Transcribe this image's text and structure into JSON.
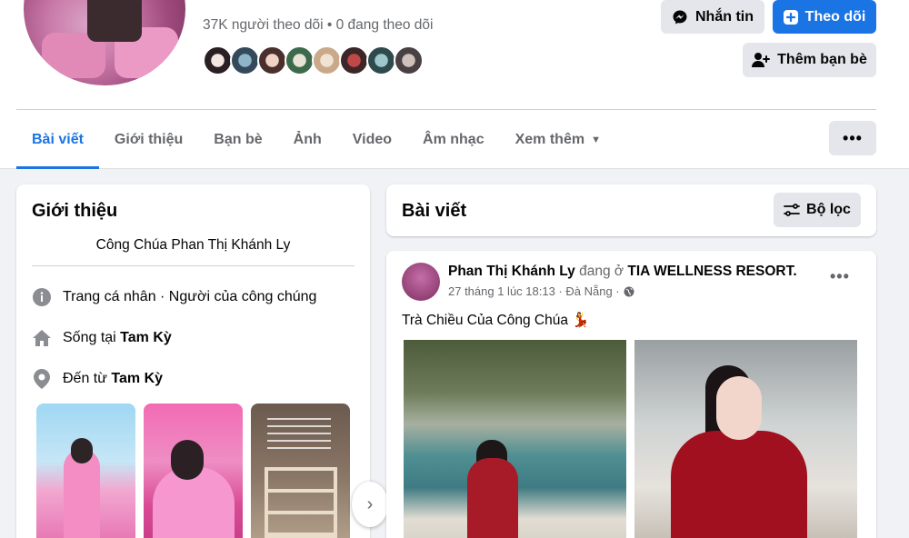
{
  "profile": {
    "follow_stats": "37K người theo dõi • 0 đang theo dõi",
    "friend_count_shown": 8
  },
  "actions": {
    "message_label": "Nhắn tin",
    "follow_label": "Theo dõi",
    "add_friend_label": "Thêm bạn bè"
  },
  "tabs": [
    {
      "label": "Bài viết",
      "active": true
    },
    {
      "label": "Giới thiệu"
    },
    {
      "label": "Bạn bè"
    },
    {
      "label": "Ảnh"
    },
    {
      "label": "Video"
    },
    {
      "label": "Âm nhạc"
    },
    {
      "label": "Xem thêm"
    }
  ],
  "more_menu_label": "•••",
  "intro": {
    "title": "Giới thiệu",
    "bio": "Công Chúa Phan Thị Khánh Ly",
    "rows": [
      {
        "icon": "info-icon",
        "prefix": "Trang cá nhân · Người của công chúng",
        "bold": ""
      },
      {
        "icon": "home-icon",
        "prefix": "Sống tại ",
        "bold": "Tam Kỳ"
      },
      {
        "icon": "location-pin-icon",
        "prefix": "Đến từ ",
        "bold": "Tam Kỳ"
      }
    ]
  },
  "posts_header": {
    "title": "Bài viết",
    "filter_label": "Bộ lọc"
  },
  "post": {
    "author": "Phan Thị Khánh Ly",
    "action": " đang ở ",
    "place": "TIA WELLNESS RESORT.",
    "timestamp": "27 tháng 1 lúc 18:13 · Đà Nẵng ·",
    "text": "Trà Chiều Của Công Chúa 💃",
    "options": "•••"
  },
  "colors": {
    "accent": "#1b74e4",
    "secondary_text": "#65676b",
    "button_gray": "#e4e6eb",
    "page_bg": "#f0f2f5"
  }
}
